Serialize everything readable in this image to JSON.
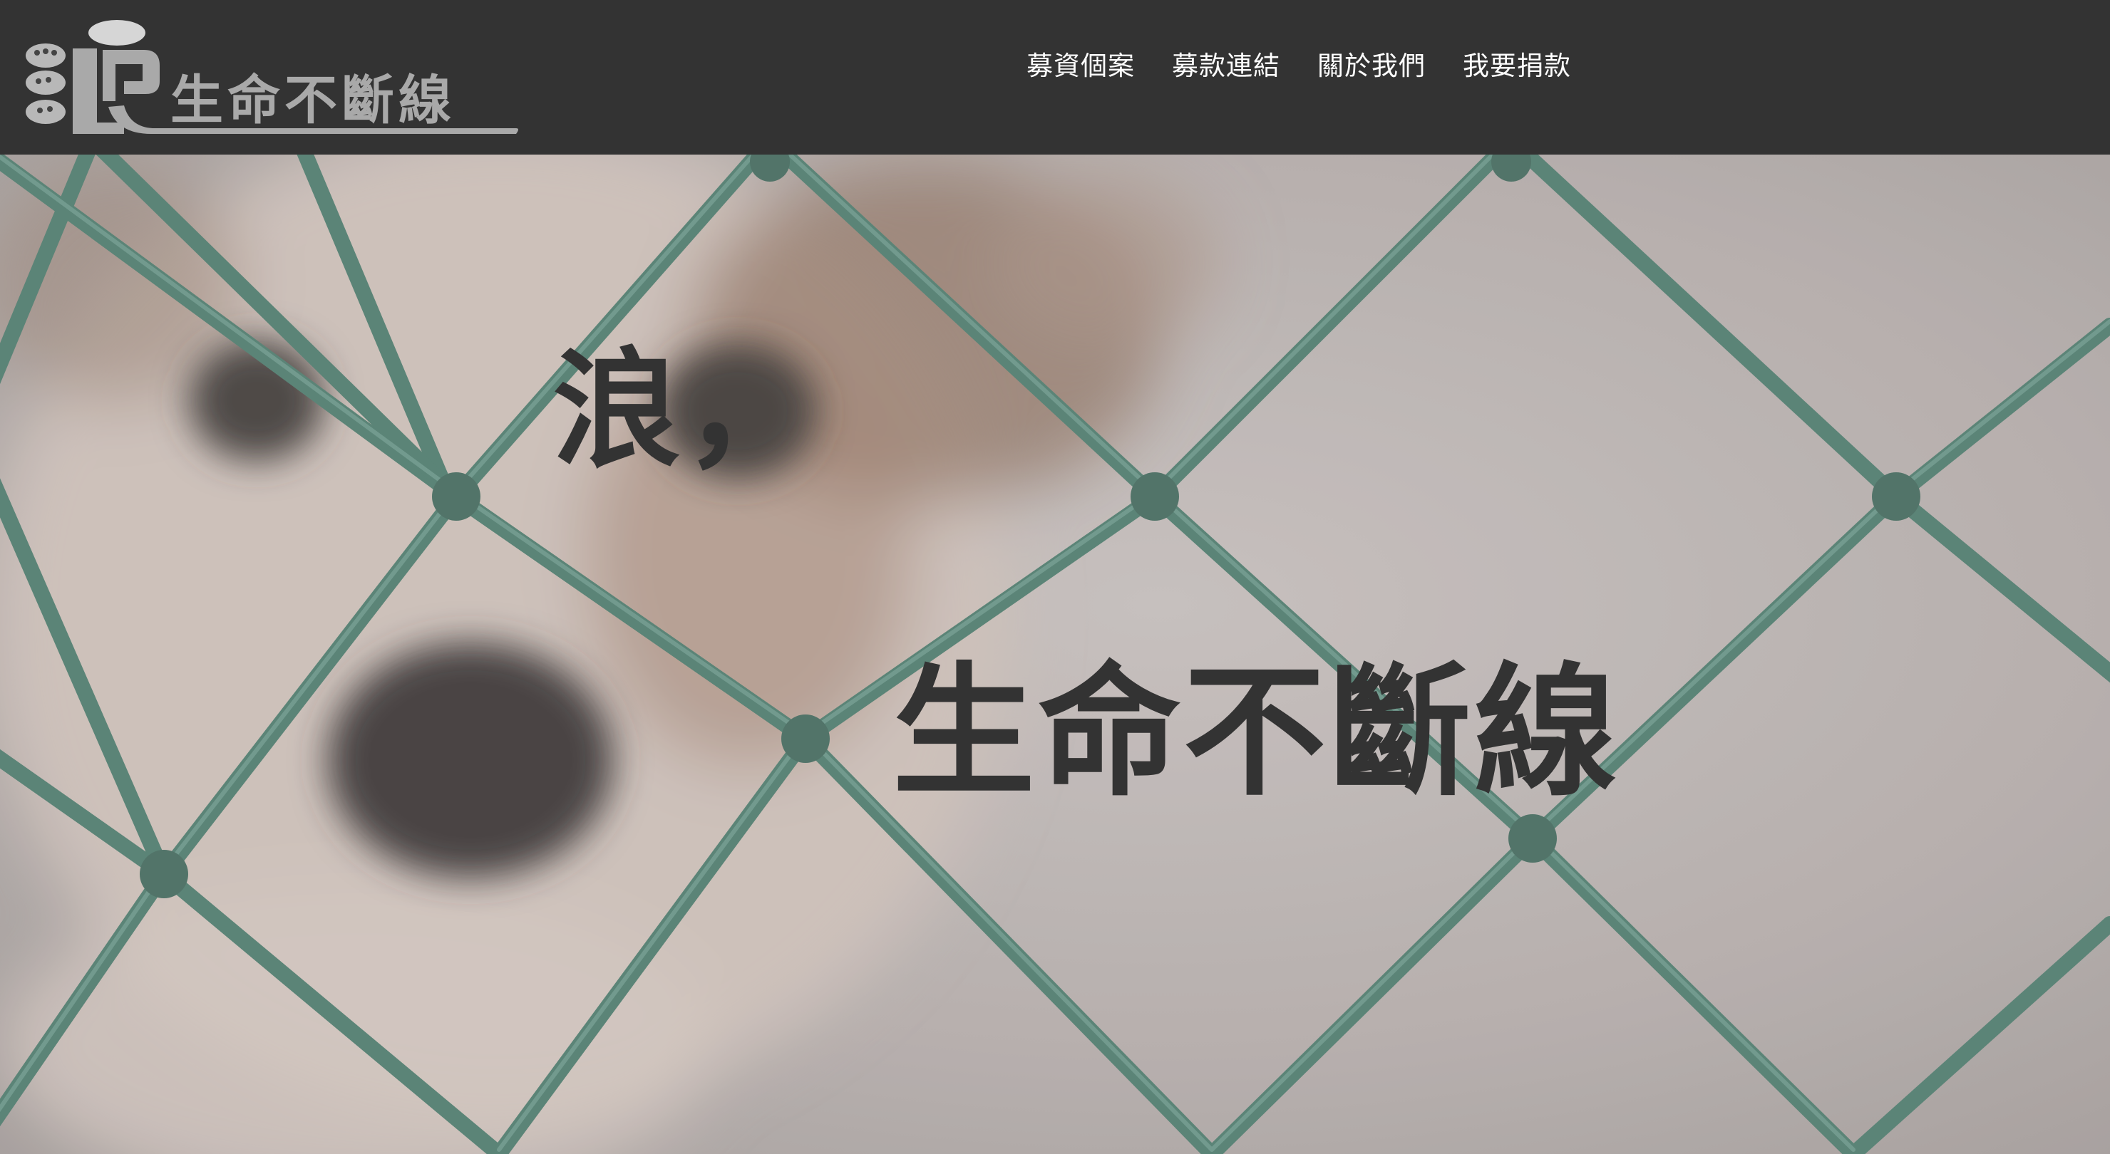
{
  "header": {
    "logo_text": "生命不斷線",
    "nav": [
      {
        "label": "募資個案"
      },
      {
        "label": "募款連結"
      },
      {
        "label": "關於我們"
      },
      {
        "label": "我要捐款"
      }
    ]
  },
  "hero": {
    "line1": "浪，",
    "line2": "生命不斷線"
  },
  "colors": {
    "header_bg": "#333333",
    "nav_text": "#ffffff",
    "logo_gray": "#a9a9a9",
    "hero_text": "#333333",
    "fence_green": "#4e7a6c"
  },
  "icons": [
    "paw-print-icon",
    "logo-mark-icon"
  ]
}
